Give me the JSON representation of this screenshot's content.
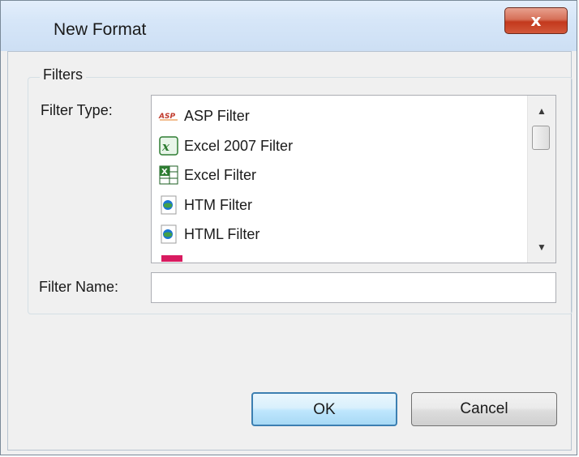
{
  "window": {
    "title": "New Format",
    "close_glyph": "x"
  },
  "filters_group": {
    "legend": "Filters",
    "filter_type_label": "Filter Type:",
    "filter_name_label": "Filter Name:",
    "filter_name_value": "",
    "filter_types": [
      {
        "label": "ASP Filter",
        "icon": "asp-icon"
      },
      {
        "label": "Excel 2007 Filter",
        "icon": "excel-2007-icon"
      },
      {
        "label": "Excel Filter",
        "icon": "excel-icon"
      },
      {
        "label": "HTM Filter",
        "icon": "htm-globe-icon"
      },
      {
        "label": "HTML Filter",
        "icon": "html-globe-icon"
      }
    ]
  },
  "buttons": {
    "ok_label": "OK",
    "cancel_label": "Cancel"
  },
  "colors": {
    "titlebar": "#d6e6f8",
    "close_button": "#c3391d",
    "ok_border": "#3c7fb1",
    "dialog_background": "#f0f0f0"
  }
}
